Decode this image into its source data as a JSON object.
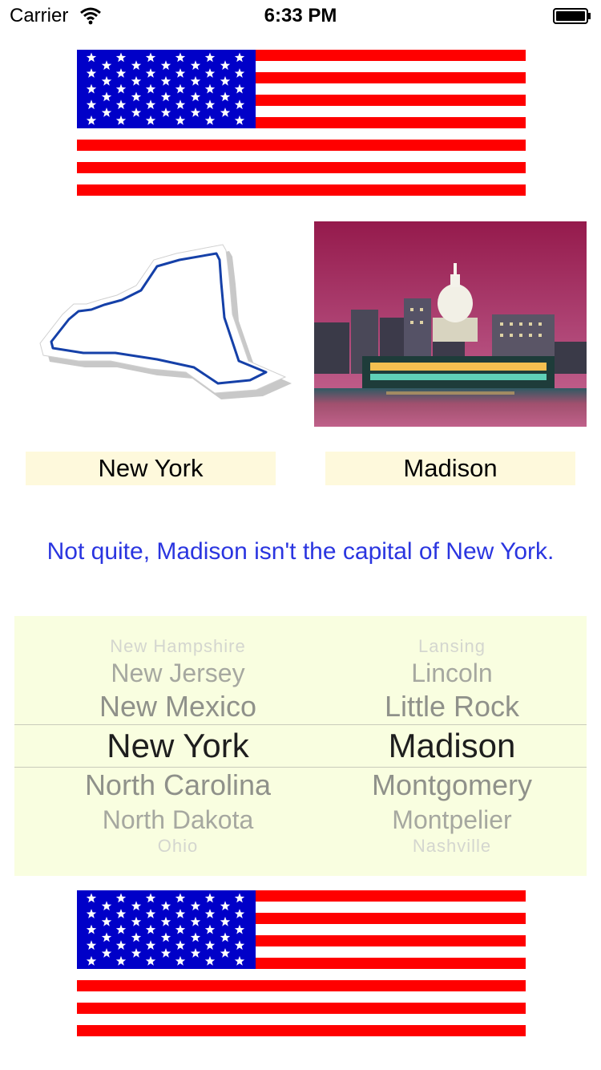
{
  "status_bar": {
    "carrier": "Carrier",
    "time": "6:33 PM",
    "wifi_icon": "wifi-icon",
    "battery_icon": "battery-icon"
  },
  "colors": {
    "flag_red": "#ff0000",
    "flag_blue": "#0000c8",
    "label_bg": "#fef9dc",
    "feedback_text": "#2a35e0",
    "picker_bg": "#f9fee0"
  },
  "quiz": {
    "state_label": "New York",
    "capital_label": "Madison",
    "feedback": "Not quite, Madison isn't the capital of New York."
  },
  "picker": {
    "states": [
      "New Hampshire",
      "New Jersey",
      "New Mexico",
      "New York",
      "North Carolina",
      "North Dakota",
      "Ohio"
    ],
    "capitals": [
      "Lansing",
      "Lincoln",
      "Little Rock",
      "Madison",
      "Montgomery",
      "Montpelier",
      "Nashville"
    ],
    "selected_state": "New York",
    "selected_capital": "Madison"
  }
}
